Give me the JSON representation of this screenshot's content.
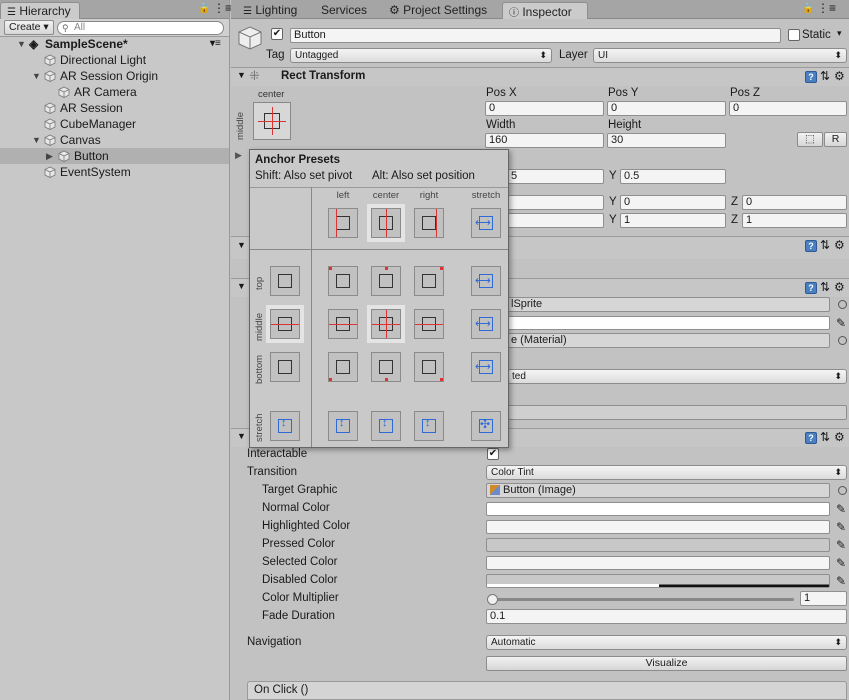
{
  "hierarchy": {
    "tab": "Hierarchy",
    "create_label": "Create",
    "search_placeholder": "All",
    "items": [
      {
        "label": "SampleScene*"
      },
      {
        "label": "Directional Light"
      },
      {
        "label": "AR Session Origin"
      },
      {
        "label": "AR Camera"
      },
      {
        "label": "AR Session"
      },
      {
        "label": "CubeManager"
      },
      {
        "label": "Canvas"
      },
      {
        "label": "Button"
      },
      {
        "label": "EventSystem"
      }
    ]
  },
  "tabs": [
    "Lighting",
    "Services",
    "Project Settings",
    "Inspector"
  ],
  "inspector": {
    "object_name": "Button",
    "static_label": "Static",
    "tag_label": "Tag",
    "tag_value": "Untagged",
    "layer_label": "Layer",
    "layer_value": "UI",
    "rect_title": "Rect Transform",
    "anchor_h": "center",
    "anchor_v": "middle",
    "posx_label": "Pos X",
    "posx": "0",
    "posy_label": "Pos Y",
    "posy": "0",
    "posz_label": "Pos Z",
    "posz": "0",
    "width_label": "Width",
    "width": "160",
    "height_label": "Height",
    "height": "30",
    "r_label": "R",
    "pivot_x_partial": "5",
    "pivot_y_label": "Y",
    "pivot_y": "0.5",
    "rot_y_label": "Y",
    "rot_y": "0",
    "rot_z_label": "Z",
    "rot_z": "0",
    "scale_y_label": "Y",
    "scale_y": "1",
    "scale_z_label": "Z",
    "scale_z": "1",
    "image_sprite_partial": "lSprite",
    "image_material_partial": "e (Material)",
    "image_type_partial": "ted",
    "interactable_label": "Interactable",
    "transition_label": "Transition",
    "transition_value": "Color Tint",
    "target_graphic_label": "Target Graphic",
    "target_graphic_value": "Button (Image)",
    "normal_color_label": "Normal Color",
    "highlighted_color_label": "Highlighted Color",
    "pressed_color_label": "Pressed Color",
    "selected_color_label": "Selected Color",
    "disabled_color_label": "Disabled Color",
    "color_multiplier_label": "Color Multiplier",
    "color_multiplier_value": "1",
    "color_multiplier_fraction": 0.0,
    "fade_duration_label": "Fade Duration",
    "fade_duration_value": "0.1",
    "navigation_label": "Navigation",
    "navigation_value": "Automatic",
    "visualize_label": "Visualize",
    "onclick_label": "On Click ()"
  },
  "presets": {
    "title": "Anchor Presets",
    "shift_hint": "Shift: Also set pivot",
    "alt_hint": "Alt: Also set position",
    "cols": [
      "left",
      "center",
      "right",
      "stretch"
    ],
    "rows": [
      "top",
      "middle",
      "bottom",
      "stretch"
    ]
  },
  "colors": {
    "anchor_red": "#dd3333",
    "stretch_blue": "#2e6bd6",
    "selection_gray": "#b0b0b0"
  }
}
